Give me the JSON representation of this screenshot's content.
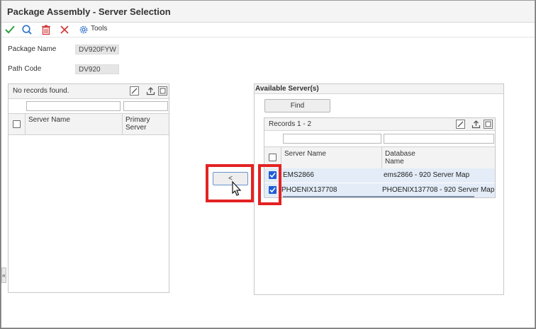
{
  "window": {
    "title": "Package Assembly - Server Selection"
  },
  "toolbar": {
    "ok_icon": "check-icon",
    "search_icon": "search-icon",
    "delete_icon": "trash-icon",
    "cancel_icon": "close-icon",
    "tools_icon": "gear-icon",
    "tools_label": "Tools"
  },
  "form": {
    "package_name": {
      "label": "Package Name",
      "value": "DV920FYW"
    },
    "path_code": {
      "label": "Path Code",
      "value": "DV920"
    }
  },
  "selected_grid": {
    "status": "No records found.",
    "columns": [
      "Server Name",
      "Primary Server"
    ],
    "rows": []
  },
  "move_button": {
    "label": "<"
  },
  "available": {
    "title": "Available Server(s)",
    "find_label": "Find",
    "records_label": "Records 1 - 2",
    "columns": [
      "Server Name",
      "Database Name"
    ],
    "rows": [
      {
        "server": "EMS2866",
        "database": "ems2866 - 920 Server Map",
        "checked": true
      },
      {
        "server": "PHOENIX137708",
        "database": "PHOENIX137708 - 920 Server Map",
        "checked": true
      }
    ]
  },
  "colors": {
    "accent_blue": "#1f5cd6",
    "highlight_red": "#e32222",
    "check_green": "#2e9e3e"
  }
}
